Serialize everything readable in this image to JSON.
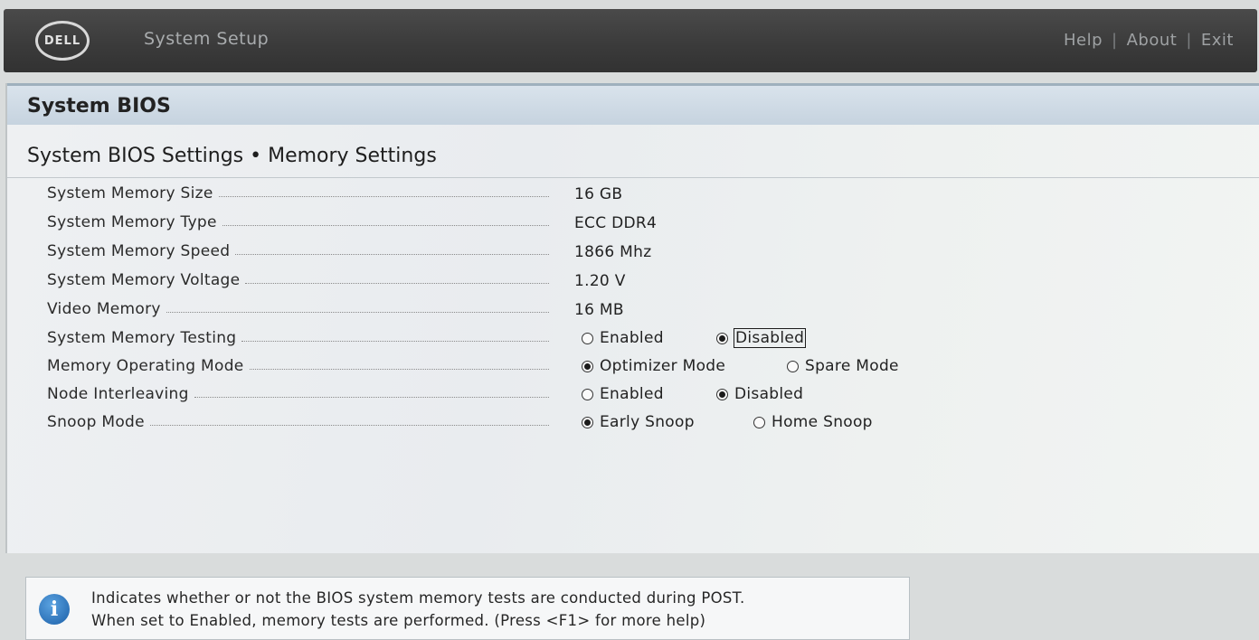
{
  "header": {
    "logo_text": "DELL",
    "title": "System Setup",
    "nav": [
      {
        "label": "Help"
      },
      {
        "label": "About"
      },
      {
        "label": "Exit"
      }
    ],
    "separator": "|"
  },
  "page": {
    "title": "System BIOS",
    "section_title": "System BIOS Settings • Memory Settings"
  },
  "settings": [
    {
      "label": "System Memory Size",
      "value": "16 GB"
    },
    {
      "label": "System Memory Type",
      "value": "ECC DDR4"
    },
    {
      "label": "System Memory Speed",
      "value": "1866 Mhz"
    },
    {
      "label": "System Memory Voltage",
      "value": "1.20 V"
    },
    {
      "label": "Video Memory",
      "value": "16 MB"
    },
    {
      "label": "System Memory Testing",
      "options": [
        {
          "label": "Enabled",
          "selected": false
        },
        {
          "label": "Disabled",
          "selected": true
        }
      ]
    },
    {
      "label": "Memory Operating Mode",
      "options": [
        {
          "label": "Optimizer Mode",
          "selected": true
        },
        {
          "label": "Spare Mode",
          "selected": false
        }
      ]
    },
    {
      "label": "Node Interleaving",
      "options": [
        {
          "label": "Enabled",
          "selected": false
        },
        {
          "label": "Disabled",
          "selected": true
        }
      ]
    },
    {
      "label": "Snoop Mode",
      "options": [
        {
          "label": "Early Snoop",
          "selected": true
        },
        {
          "label": "Home Snoop",
          "selected": false
        }
      ]
    }
  ],
  "help": {
    "icon": "info-icon",
    "line1": "Indicates whether or not the BIOS system memory tests are conducted during POST.",
    "line2": "When set to Enabled, memory tests are performed. (Press <F1> for more help)"
  },
  "colors": {
    "topbar": "#3a3a3a",
    "bios_bar": "#c6d3df",
    "info": "#1b5fa8"
  }
}
